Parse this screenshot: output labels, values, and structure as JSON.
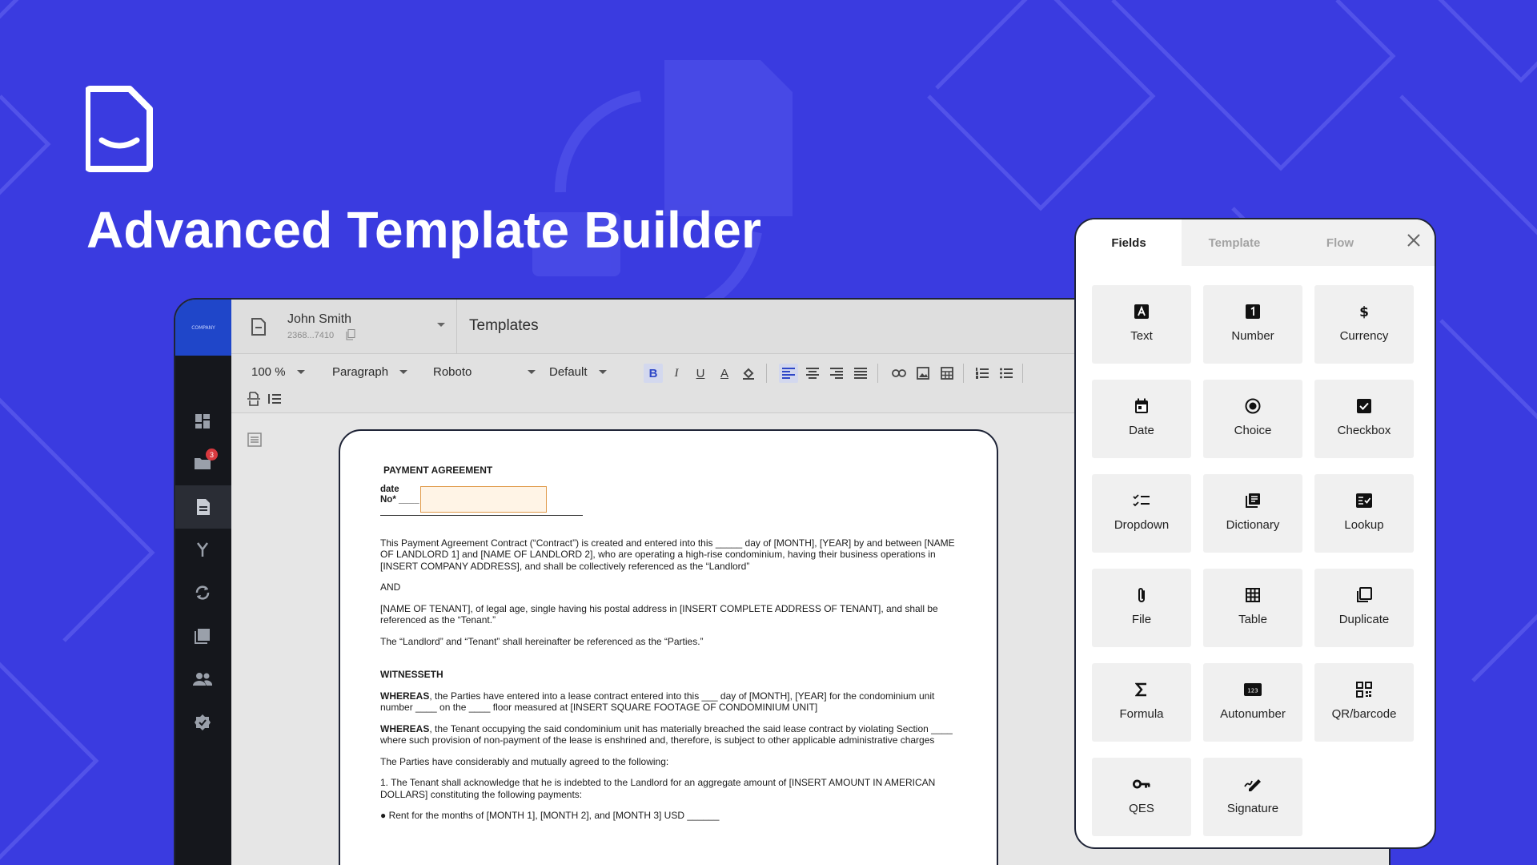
{
  "hero": {
    "title": "Advanced Template Builder"
  },
  "app": {
    "rail": {
      "brand": "COMPANY",
      "badge_count": "3"
    },
    "user": {
      "name": "John Smith",
      "id": "2368...7410"
    },
    "page_heading": "Templates",
    "toolbar": {
      "zoom": "100 %",
      "block_style": "Paragraph",
      "font": "Roboto",
      "size": "Default",
      "bold": "B",
      "italic": "I",
      "underline": "U",
      "text_color": "A"
    }
  },
  "document": {
    "title": "PAYMENT AGREEMENT",
    "meta_date_label": "date",
    "meta_no_label": "No*",
    "meta_no_blank": "____",
    "p1": "This Payment Agreement Contract (“Contract”) is created and entered into this _____ day of [MONTH], [YEAR] by and between [NAME OF LANDLORD 1] and [NAME OF LANDLORD 2], who are operating a high-rise condominium, having their business operations in [INSERT COMPANY ADDRESS], and shall be collectively referenced as the “Landlord”",
    "and": "AND",
    "p2": "[NAME OF TENANT], of legal age, single having his postal address in [INSERT COMPLETE ADDRESS OF TENANT], and shall be referenced as the “Tenant.”",
    "p3": "The “Landlord” and “Tenant” shall hereinafter be referenced as the “Parties.”",
    "witnesseth": "WITNESSETH",
    "whereas_label": "WHEREAS",
    "w1": ", the Parties have entered into a lease contract entered into this ___ day of [MONTH], [YEAR] for the condominium unit number ____ on the  ____ floor measured at [INSERT SQUARE FOOTAGE OF CONDOMINIUM UNIT]",
    "w2": ", the Tenant occupying the said condominium unit has materially breached the said lease contract by violating Section ____ where such provision of non-payment of the lease is enshrined and, therefore, is subject to other applicable administrative charges",
    "p4": "The Parties have considerably and mutually agreed to the following:",
    "p5": "1. The Tenant shall acknowledge that he is indebted to the Landlord for an aggregate amount of [INSERT AMOUNT IN AMERICAN DOLLARS] constituting the following payments:",
    "p6": "● Rent for the months of [MONTH 1], [MONTH 2], and [MONTH 3] USD ______"
  },
  "panel": {
    "tabs": [
      "Fields",
      "Template",
      "Flow"
    ],
    "fields": [
      {
        "label": "Text",
        "icon": "text-field-icon"
      },
      {
        "label": "Number",
        "icon": "number-field-icon"
      },
      {
        "label": "Currency",
        "icon": "currency-icon"
      },
      {
        "label": "Date",
        "icon": "calendar-icon"
      },
      {
        "label": "Choice",
        "icon": "radio-icon"
      },
      {
        "label": "Checkbox",
        "icon": "checkbox-icon"
      },
      {
        "label": "Dropdown",
        "icon": "checklist-icon"
      },
      {
        "label": "Dictionary",
        "icon": "library-icon"
      },
      {
        "label": "Lookup",
        "icon": "lookup-icon"
      },
      {
        "label": "File",
        "icon": "paperclip-icon"
      },
      {
        "label": "Table",
        "icon": "grid-icon"
      },
      {
        "label": "Duplicate",
        "icon": "duplicate-icon"
      },
      {
        "label": "Formula",
        "icon": "sigma-icon"
      },
      {
        "label": "Autonumber",
        "icon": "autonumber-icon"
      },
      {
        "label": "QR/barcode",
        "icon": "qr-code-icon"
      },
      {
        "label": "QES",
        "icon": "key-icon"
      },
      {
        "label": "Signature",
        "icon": "signature-icon"
      }
    ]
  }
}
